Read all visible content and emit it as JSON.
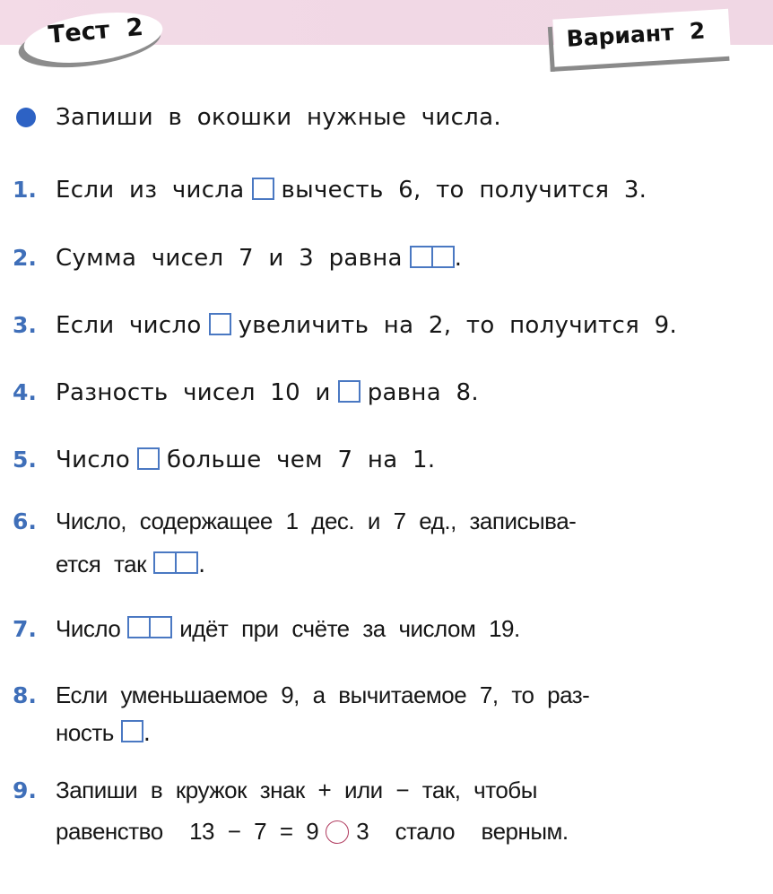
{
  "header": {
    "test_label": "Тест  2",
    "variant_label": "Вариант  2"
  },
  "intro": {
    "icon": "bullet-dot",
    "text": "Запиши в окошки нужные числа."
  },
  "colors": {
    "accent_blue": "#3f6fb9",
    "bullet_blue": "#2d62c4",
    "box_blue": "#4a78c2",
    "circle_red": "#b03a5e",
    "band_pink": "#f1d8e5"
  },
  "tasks": [
    {
      "number": "1.",
      "before": "Если из числа",
      "box": "single",
      "after": "вычесть 6, то получится 3."
    },
    {
      "number": "2.",
      "before": "Сумма чисел 7 и 3 равна",
      "box": "double",
      "after": "."
    },
    {
      "number": "3.",
      "before": "Если число",
      "box": "single",
      "after": "увеличить на 2, то получится 9."
    },
    {
      "number": "4.",
      "before": "Разность чисел 10 и",
      "box": "single",
      "after": "равна 8."
    },
    {
      "number": "5.",
      "before": "Число",
      "box": "single",
      "after": "больше чем 7 на 1."
    },
    {
      "number": "6.",
      "line1": "Число, содержащее 1 дес. и 7 ед., записыва-",
      "before": "ется так",
      "box": "double",
      "after": "."
    },
    {
      "number": "7.",
      "before": "Число",
      "box": "double",
      "after": "идёт при счёте за числом 19."
    },
    {
      "number": "8.",
      "line1": "Если уменьшаемое 9, а вычитаемое 7, то раз-",
      "before": "ность",
      "box": "single",
      "after": "."
    },
    {
      "number": "9.",
      "line1": "Запиши в кружок знак + или − так, чтобы",
      "before": "равенство  13 − 7 = 9",
      "box": "circle",
      "after": "3  стало  верным."
    }
  ]
}
